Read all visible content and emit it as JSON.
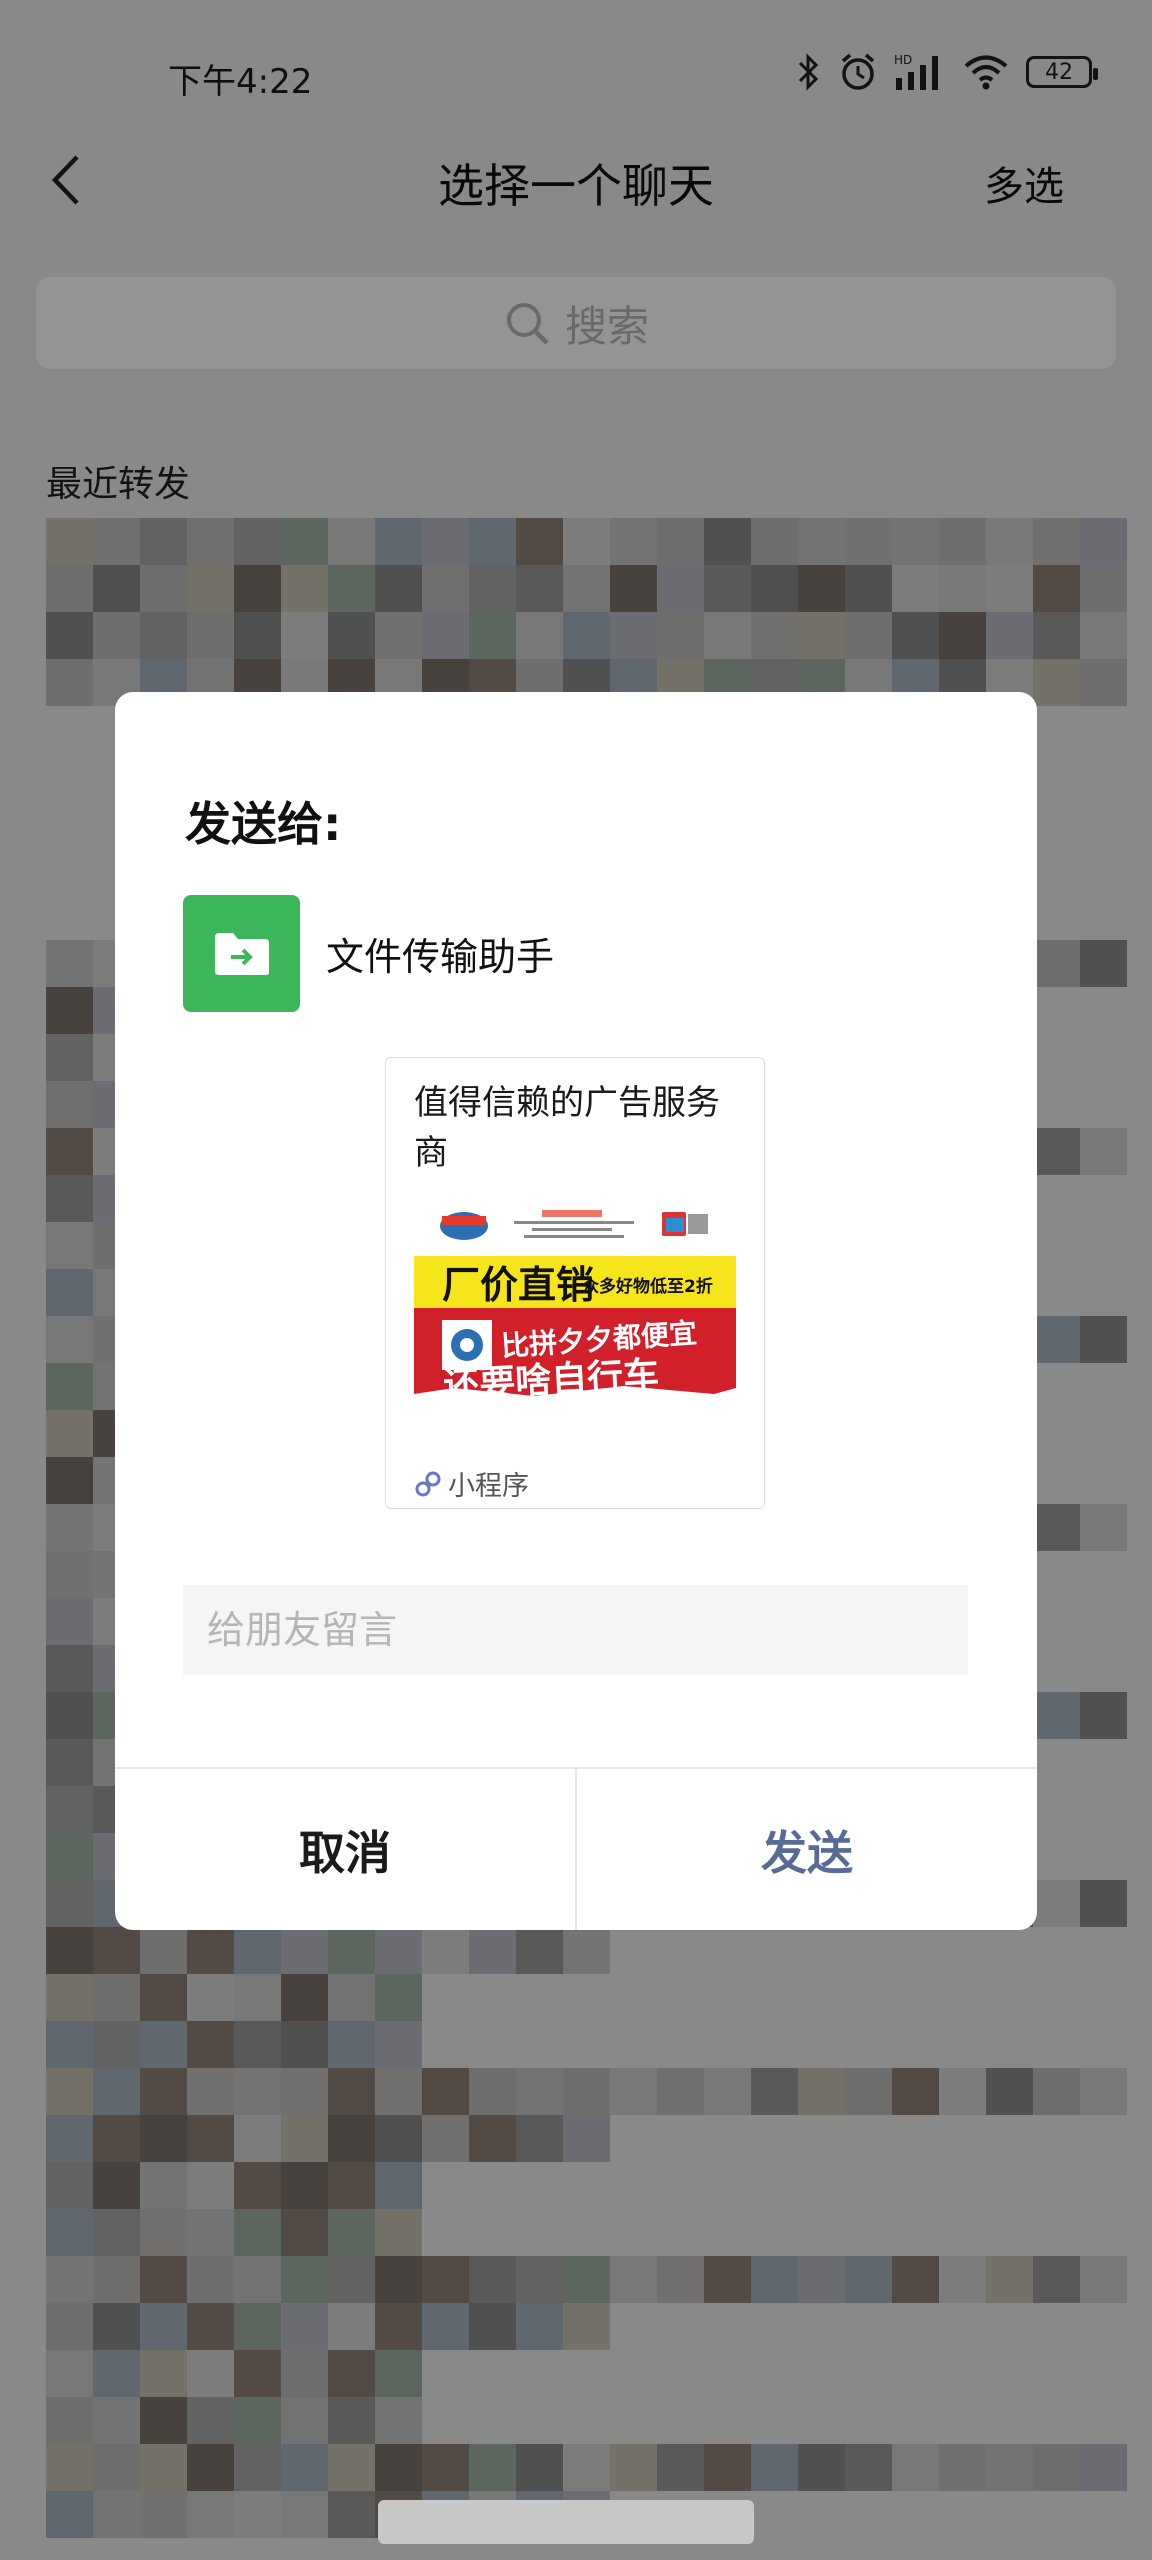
{
  "status_bar": {
    "time": "下午4:22",
    "battery": "42",
    "signal_badge": "HD",
    "icons": [
      "bluetooth-icon",
      "alarm-icon",
      "signal-icon",
      "wifi-icon",
      "battery-icon"
    ]
  },
  "header": {
    "title": "选择一个聊天",
    "multi_select": "多选"
  },
  "search": {
    "label": "搜索"
  },
  "sections": {
    "recent": "最近转发"
  },
  "dialog": {
    "title": "发送给:",
    "recipient": {
      "name": "文件传输助手",
      "avatar_color": "#3cb65a"
    },
    "card": {
      "title": "值得信赖的广告服务商",
      "image_text": {
        "headline": "厂价直销",
        "subline": "众多好物低至2折",
        "slogan1": "比拼夕夕都便宜",
        "slogan2": "还要啥自行车"
      },
      "footer": "小程序"
    },
    "message_placeholder": "给朋友留言",
    "cancel_label": "取消",
    "send_label": "发送"
  },
  "colors": {
    "accent": "#576b95",
    "file_helper_green": "#3cb65a",
    "ad_red": "#d2202a",
    "ad_yellow": "#f7e51c"
  }
}
